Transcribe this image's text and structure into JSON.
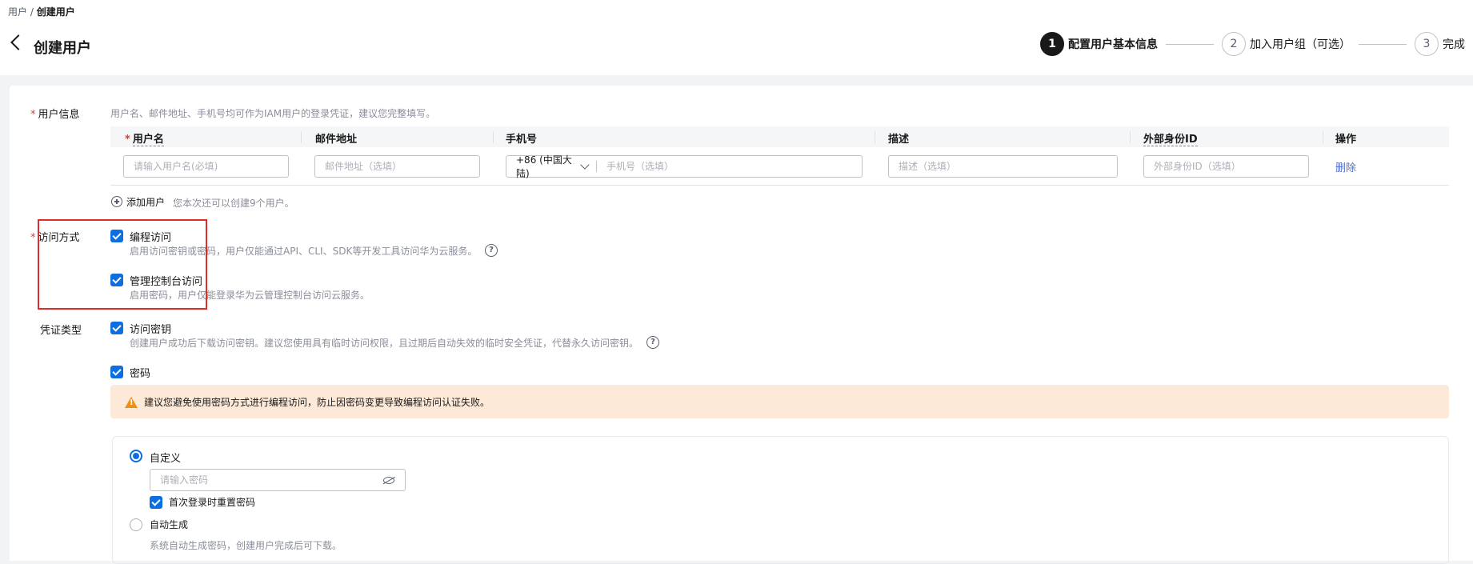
{
  "breadcrumb": {
    "parent": "用户",
    "sep": " / ",
    "current": "创建用户"
  },
  "page_title": "创建用户",
  "steps": [
    {
      "num": "1",
      "label": "配置用户基本信息",
      "active": true
    },
    {
      "num": "2",
      "label": "加入用户组（可选）",
      "active": false
    },
    {
      "num": "3",
      "label": "完成",
      "active": false
    }
  ],
  "user_info": {
    "label": "用户信息",
    "hint": "用户名、邮件地址、手机号均可作为IAM用户的登录凭证，建议您完整填写。",
    "columns": {
      "username": "用户名",
      "email": "邮件地址",
      "phone": "手机号",
      "desc": "描述",
      "external_id": "外部身份ID",
      "action": "操作"
    },
    "row": {
      "username_placeholder": "请输入用户名(必填)",
      "email_placeholder": "邮件地址（选填）",
      "phone_code": "+86 (中国大陆)",
      "phone_placeholder": "手机号（选填）",
      "desc_placeholder": "描述（选填）",
      "external_id_placeholder": "外部身份ID（选填）",
      "delete_label": "删除"
    },
    "add_user_label": "添加用户",
    "add_user_hint": "您本次还可以创建9个用户。"
  },
  "access": {
    "label": "访问方式",
    "programmatic": {
      "label": "编程访问",
      "desc": "启用访问密钥或密码，用户仅能通过API、CLI、SDK等开发工具访问华为云服务。",
      "checked": true
    },
    "console": {
      "label": "管理控制台访问",
      "desc": "启用密码，用户仅能登录华为云管理控制台访问云服务。",
      "checked": true
    }
  },
  "credential": {
    "label": "凭证类型",
    "access_key": {
      "label": "访问密钥",
      "desc": "创建用户成功后下载访问密钥。建议您使用具有临时访问权限，且过期后自动失效的临时安全凭证，代替永久访问密钥。",
      "checked": true
    },
    "password": {
      "label": "密码",
      "checked": true
    },
    "warning": "建议您避免使用密码方式进行编程访问，防止因密码变更导致编程访问认证失败。",
    "custom": {
      "label": "自定义",
      "selected": true,
      "placeholder": "请输入密码"
    },
    "reset_on_login": {
      "label": "首次登录时重置密码",
      "checked": true
    },
    "auto": {
      "label": "自动生成",
      "selected": false,
      "desc": "系统自动生成密码，创建用户完成后可下载。"
    }
  },
  "colors": {
    "primary": "#0d6ee0",
    "link": "#526ecc",
    "warning_bg": "#fde9d8",
    "required": "#e03a2f",
    "highlight_box": "#e12b2b"
  }
}
